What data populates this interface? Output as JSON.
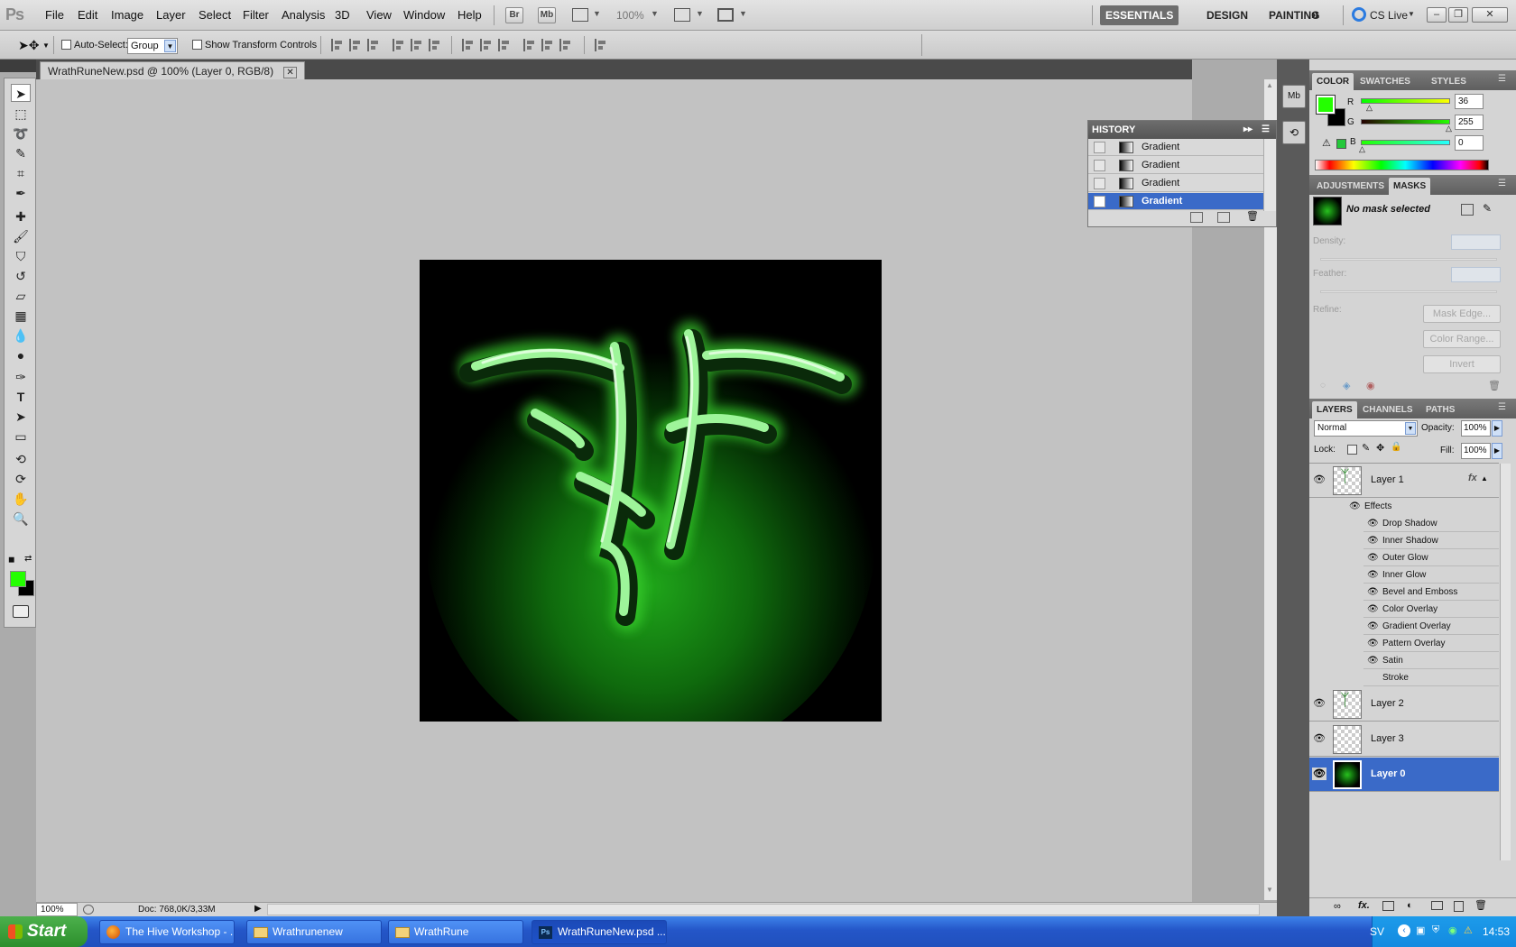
{
  "menubar": {
    "logo": "Ps",
    "menus": [
      "File",
      "Edit",
      "Image",
      "Layer",
      "Select",
      "Filter",
      "Analysis",
      "3D",
      "View",
      "Window",
      "Help"
    ],
    "bridge_label": "Br",
    "minibridge_label": "Mb",
    "zoom": "100%",
    "workspaces": [
      "ESSENTIALS",
      "DESIGN",
      "PAINTING"
    ],
    "more_ws": "»",
    "cs_live": "CS Live"
  },
  "options": {
    "auto_select_label": "Auto-Select:",
    "auto_select_value": "Group",
    "transform_label": "Show Transform Controls"
  },
  "document": {
    "tab_title": "WrathRuneNew.psd @ 100% (Layer 0, RGB/8)",
    "zoom": "100%",
    "doc_info": "Doc: 768,0K/3,33M"
  },
  "history": {
    "title": "HISTORY",
    "items": [
      "Gradient",
      "Gradient",
      "Gradient",
      "Gradient"
    ],
    "selected_index": 3
  },
  "color_panel": {
    "tabs": [
      "COLOR",
      "SWATCHES",
      "STYLES"
    ],
    "r_label": "R",
    "r_value": "36",
    "g_label": "G",
    "g_value": "255",
    "b_label": "B",
    "b_value": "0",
    "foreground_hex": "#24ff00"
  },
  "masks_panel": {
    "tabs": [
      "ADJUSTMENTS",
      "MASKS"
    ],
    "status": "No mask selected",
    "density_label": "Density:",
    "feather_label": "Feather:",
    "refine_label": "Refine:",
    "buttons": [
      "Mask Edge...",
      "Color Range...",
      "Invert"
    ]
  },
  "layers_panel": {
    "tabs": [
      "LAYERS",
      "CHANNELS",
      "PATHS"
    ],
    "blend_mode": "Normal",
    "opacity_label": "Opacity:",
    "opacity_value": "100%",
    "lock_label": "Lock:",
    "fill_label": "Fill:",
    "fill_value": "100%",
    "layer1": "Layer 1",
    "fx_badge": "fx",
    "effects_label": "Effects",
    "effects": [
      "Drop Shadow",
      "Inner Shadow",
      "Outer Glow",
      "Inner Glow",
      "Bevel and Emboss",
      "Color Overlay",
      "Gradient Overlay",
      "Pattern Overlay",
      "Satin",
      "Stroke"
    ],
    "layer2": "Layer 2",
    "layer3": "Layer 3",
    "layer0": "Layer 0"
  },
  "taskbar": {
    "start": "Start",
    "tasks": [
      "The Hive Workshop - ...",
      "Wrathrunenew",
      "WrathRune",
      "WrathRuneNew.psd ..."
    ],
    "language": "SV",
    "clock": "14:53"
  }
}
